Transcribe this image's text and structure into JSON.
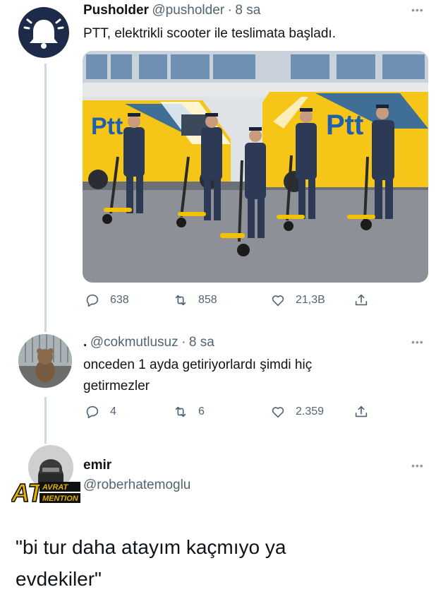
{
  "tweet1": {
    "name": "Pusholder",
    "handle": "@pusholder",
    "time": "8 sa",
    "text": "PTT, elektrikli scooter ile teslimata başladı.",
    "image_text_left": "Ptt",
    "image_text_right": "Ptt",
    "stats": {
      "replies": "638",
      "retweets": "858",
      "likes": "21,3B"
    }
  },
  "tweet2": {
    "name": ".",
    "handle": "@cokmutlusuz",
    "time": "8 sa",
    "text_line1": "onceden 1 ayda getiriyorlardı şimdi hiç",
    "text_line2": "getirmezler",
    "stats": {
      "replies": "4",
      "retweets": "6",
      "likes": "2.359"
    }
  },
  "tweet3": {
    "name": "emir",
    "handle": "@roberhatemoglu",
    "text_line1": "\"bi tur daha atayım kaçmıyo ya",
    "text_line2": "evdekiler\""
  },
  "watermark": {
    "main": "AT",
    "line1": "AVRAT",
    "line2": "MENTION"
  },
  "colors": {
    "ptt_yellow": "#f5c518",
    "ptt_blue": "#1f5fae",
    "text_gray": "#536471",
    "navy": "#1e2a4a"
  },
  "icons": [
    "bell-icon",
    "reply-icon",
    "retweet-icon",
    "like-icon",
    "share-icon",
    "more-icon"
  ]
}
